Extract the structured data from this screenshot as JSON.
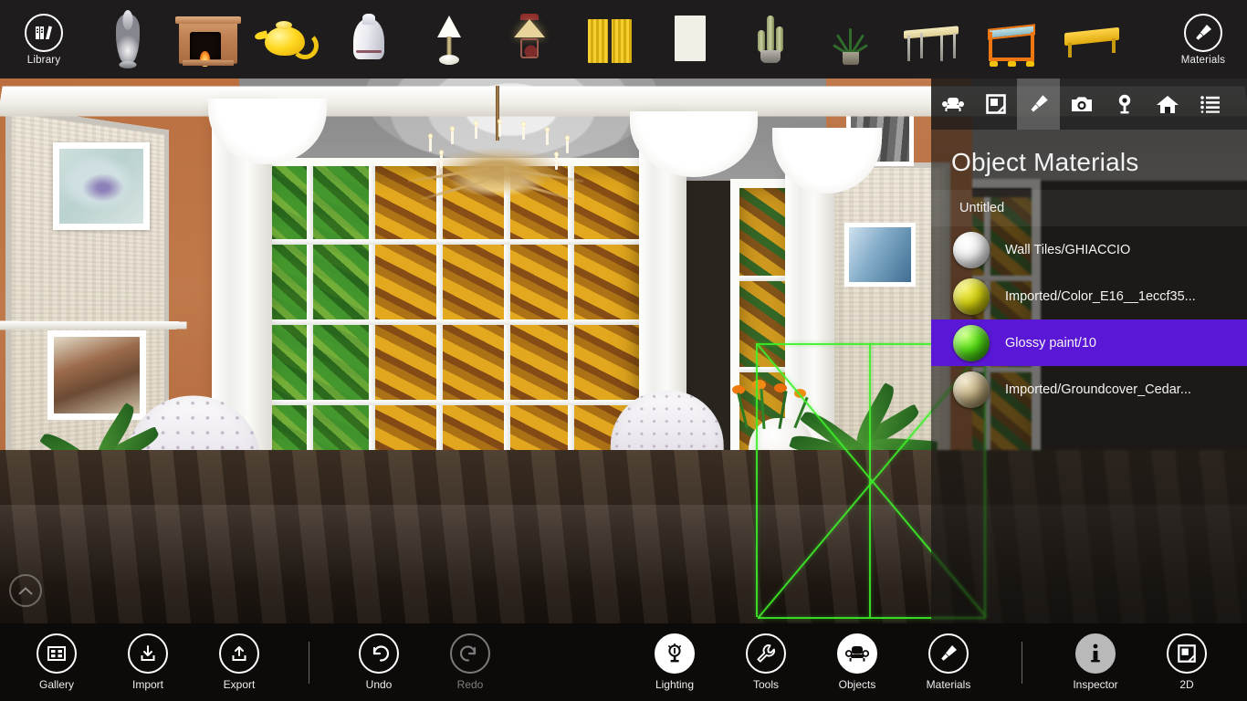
{
  "toolbar": {
    "library_label": "Library",
    "materials_label": "Materials",
    "library_icon": "books-icon",
    "materials_icon": "paintbrush-icon",
    "objects": [
      {
        "name": "silver-vase-thumbnail",
        "kind": "vase"
      },
      {
        "name": "fireplace-thumbnail",
        "kind": "fireplace"
      },
      {
        "name": "teapot-thumbnail",
        "kind": "teapot"
      },
      {
        "name": "milk-jug-thumbnail",
        "kind": "jug"
      },
      {
        "name": "table-lamp-white-thumbnail",
        "kind": "lamp"
      },
      {
        "name": "table-lamp-shade-thumbnail",
        "kind": "tlamp"
      },
      {
        "name": "curtains-thumbnail",
        "kind": "curtain"
      },
      {
        "name": "mona-lisa-painting-thumbnail",
        "kind": "painting"
      },
      {
        "name": "cactus-thumbnail",
        "kind": "cactus"
      },
      {
        "name": "potted-plant-thumbnail",
        "kind": "plant"
      },
      {
        "name": "white-table-thumbnail",
        "kind": "table"
      },
      {
        "name": "orange-table-thumbnail",
        "kind": "orangetable"
      },
      {
        "name": "yellow-table-thumbnail",
        "kind": "yellowtable"
      }
    ]
  },
  "panel": {
    "title": "Object Materials",
    "group_label": "Untitled",
    "selection_color": "#5a17d6",
    "tabs": [
      {
        "name": "tab-objects",
        "icon": "armchair-icon",
        "active": false
      },
      {
        "name": "tab-floorplan",
        "icon": "floorplan-icon",
        "active": false
      },
      {
        "name": "tab-materials",
        "icon": "paintbrush-icon",
        "active": true
      },
      {
        "name": "tab-camera",
        "icon": "camera-icon",
        "active": false
      },
      {
        "name": "tab-lighting",
        "icon": "bulb-icon",
        "active": false
      },
      {
        "name": "tab-home",
        "icon": "home-icon",
        "active": false
      },
      {
        "name": "tab-list",
        "icon": "list-icon",
        "active": false
      }
    ],
    "materials": [
      {
        "label": "Wall Tiles/GHIACCIO",
        "color": "#f2f2f2",
        "selected": false
      },
      {
        "label": "Imported/Color_E16__1eccf35...",
        "color": "#c9c70a",
        "selected": false
      },
      {
        "label": "Glossy paint/10",
        "color": "#4ddd12",
        "selected": true
      },
      {
        "label": "Imported/Groundcover_Cedar...",
        "color": "#c2b183",
        "selected": false
      }
    ]
  },
  "bottombar": {
    "items": [
      {
        "name": "gallery-button",
        "label": "Gallery",
        "icon": "gallery-icon",
        "style": "outline"
      },
      {
        "name": "import-button",
        "label": "Import",
        "icon": "download-icon",
        "style": "outline"
      },
      {
        "name": "export-button",
        "label": "Export",
        "icon": "upload-icon",
        "style": "outline"
      },
      {
        "name": "undo-button",
        "label": "Undo",
        "icon": "undo-arrow-icon",
        "style": "outline"
      },
      {
        "name": "redo-button",
        "label": "Redo",
        "icon": "redo-arrow-icon",
        "style": "disabled"
      },
      {
        "name": "lighting-button",
        "label": "Lighting",
        "icon": "bulb-icon",
        "style": "filled"
      },
      {
        "name": "tools-button",
        "label": "Tools",
        "icon": "wrench-icon",
        "style": "filled"
      },
      {
        "name": "objects-button",
        "label": "Objects",
        "icon": "armchair-icon",
        "style": "filled"
      },
      {
        "name": "materials-button",
        "label": "Materials",
        "icon": "paintbrush-icon",
        "style": "filled"
      },
      {
        "name": "inspector-button",
        "label": "Inspector",
        "icon": "info-icon",
        "style": "grey"
      },
      {
        "name": "view-2d-button",
        "label": "2D",
        "icon": "floorplan-icon",
        "style": "outline"
      }
    ]
  },
  "viewport": {
    "scroll_up_icon": "chevron-up-icon",
    "selection_wireframe_color": "#3cf028"
  }
}
